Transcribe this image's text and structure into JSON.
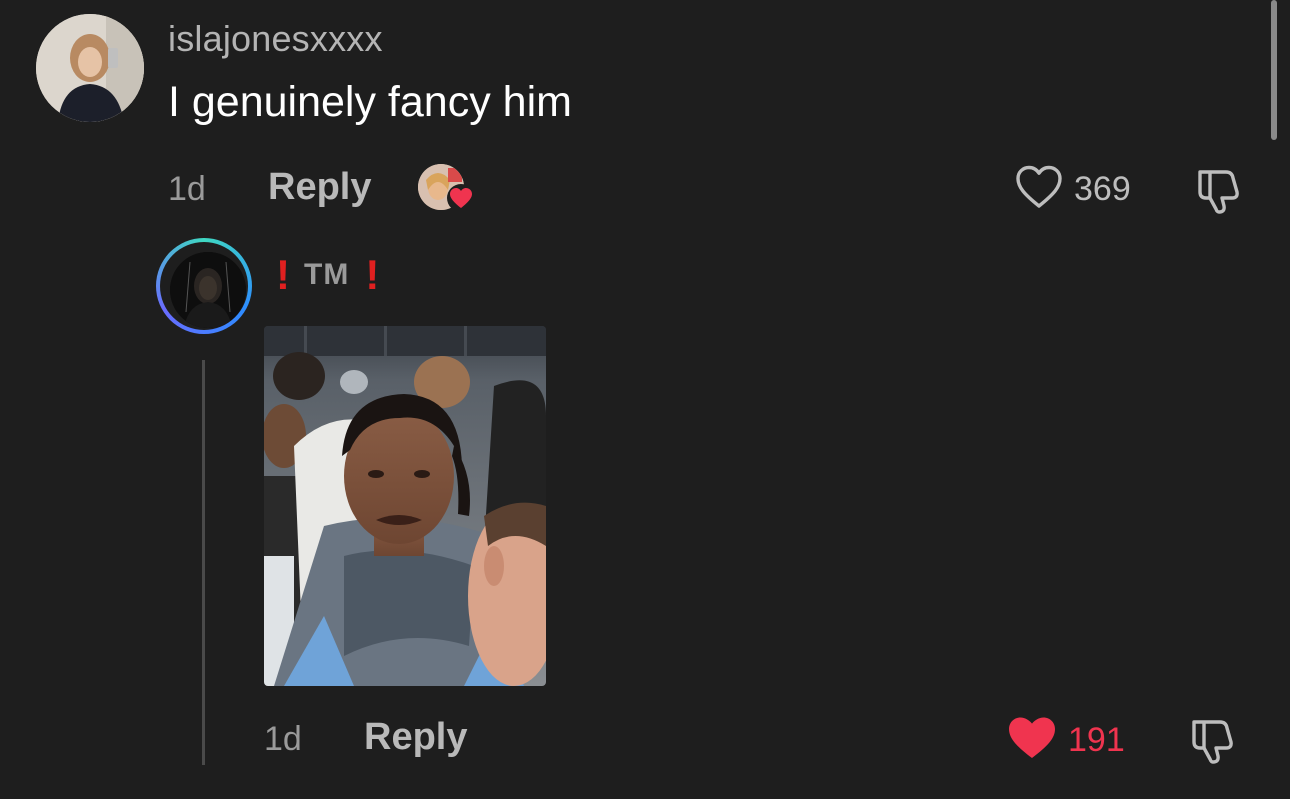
{
  "comment": {
    "username": "islajonesxxxx",
    "text": "I genuinely fancy him",
    "time": "1d",
    "reply_label": "Reply",
    "likes": "369",
    "liked": false,
    "creator_liked": true
  },
  "reply": {
    "username_bang_left": "!",
    "username_text": "TM",
    "username_bang_right": "!",
    "time": "1d",
    "reply_label": "Reply",
    "likes": "191",
    "liked": true,
    "has_image": true
  },
  "colors": {
    "background": "#1e1e1e",
    "like_red": "#f0344f",
    "muted_text": "#9a9a9a",
    "ring_start": "#3fd8c2",
    "ring_end": "#2d8cff"
  },
  "icons": {
    "like_outline": "heart-outline-icon",
    "like_filled": "heart-filled-icon",
    "dislike": "thumbs-down-icon"
  }
}
